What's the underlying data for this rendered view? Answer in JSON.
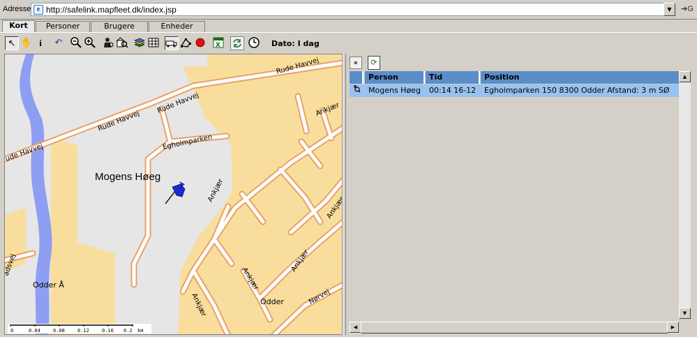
{
  "address_bar": {
    "label": "Adresse",
    "url": "http://safelink.mapfleet.dk/index.jsp",
    "go_label": "G"
  },
  "tabs": [
    {
      "label": "Kort",
      "active": true
    },
    {
      "label": "Personer",
      "active": false
    },
    {
      "label": "Brugere",
      "active": false
    },
    {
      "label": "Enheder",
      "active": false
    }
  ],
  "toolbar": {
    "tools": [
      "pointer-icon",
      "hand-icon",
      "info-icon",
      "undo-icon",
      "zoom-out-icon",
      "zoom-in-icon",
      "find-person-icon",
      "find-address-icon",
      "layers-icon",
      "grid-icon",
      "route-icon",
      "polygon-icon",
      "record-icon",
      "excel-icon",
      "refresh-icon",
      "clock-icon"
    ],
    "date_label": "Dato: I dag"
  },
  "map": {
    "labels": {
      "road_rude_havvej_1": "Rude Havvej",
      "road_rude_havvej_2": "Rude Havvej",
      "road_rude_havvej_3": "ude Havvej",
      "road_egholmparken": "Egholmparken",
      "road_ankjaer_1": "Ankjær",
      "road_ankjaer_2": "Ankjær",
      "road_ankjaer_3": "Ankjær",
      "road_ankjaer_4": "Ankjær",
      "road_ankjaer_5": "Ankjær",
      "road_ankjaer_6": "Ankjær",
      "road_ankjaer_7": "Ankjær",
      "road_noervej": "Nørvej",
      "road_aadsvej": "ådsvej",
      "place_odder_aa": "Odder Å",
      "place_odder": "Odder",
      "person_marker": "Mogens Høeg"
    },
    "scale": {
      "ticks": [
        "0",
        "0.04",
        "0.08",
        "0.12",
        "0.16",
        "0.2"
      ],
      "unit": "km"
    },
    "colors": {
      "land": "#e6e6e6",
      "residential": "#f9dd9c",
      "water": "#8e9ef2",
      "road_fill": "#ffffff",
      "road_border": "#e8a165",
      "pin": "#1c2bd1"
    }
  },
  "right_panel": {
    "columns": [
      "Person",
      "Tid",
      "Position"
    ],
    "rows": [
      {
        "person": "Mogens Høeg",
        "tid": "00:14 16-12",
        "position": "Egholmparken 150 8300 Odder Afstand: 3 m SØ"
      }
    ],
    "colors": {
      "header": "#5b8dc9",
      "row": "#99c2ee"
    }
  }
}
